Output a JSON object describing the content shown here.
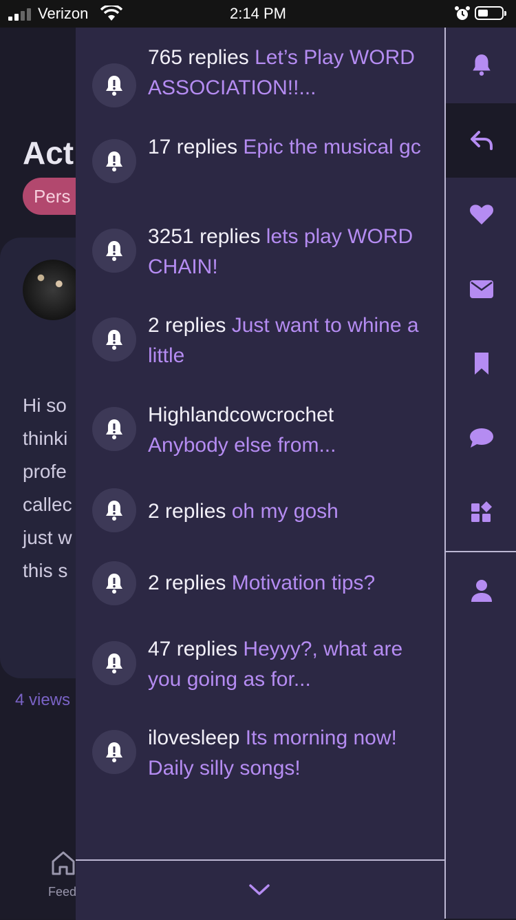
{
  "status_bar": {
    "carrier": "Verizon",
    "time": "2:14 PM"
  },
  "background": {
    "title": "Act",
    "chip": "Pers",
    "body_lines": [
      "Hi so",
      "thinki",
      "profe",
      "callec",
      "just w",
      "this s"
    ],
    "views": "4 views",
    "nav_feed_label": "Feed"
  },
  "notifications": [
    {
      "who": "765 replies",
      "topic": "Let’s Play WORD ASSOCIATION!!..."
    },
    {
      "who": "17 replies",
      "topic": "Epic the musical gc"
    },
    {
      "who": "3251 replies",
      "topic": "lets play WORD CHAIN!"
    },
    {
      "who": "2 replies",
      "topic": "Just want to whine a little"
    },
    {
      "who": "Highlandcowcrochet",
      "topic": "Anybody else from..."
    },
    {
      "who": "2 replies",
      "topic": "oh my gosh"
    },
    {
      "who": "2 replies",
      "topic": "Motivation tips?"
    },
    {
      "who": "47 replies",
      "topic": "Heyyy?, what are you going as for..."
    },
    {
      "who": "ilovesleep",
      "topic": "Its morning now! Daily silly songs!"
    }
  ],
  "rail": [
    {
      "icon": "bell-icon"
    },
    {
      "icon": "reply-icon",
      "active": true
    },
    {
      "icon": "heart-icon"
    },
    {
      "icon": "envelope-icon"
    },
    {
      "icon": "bookmark-icon"
    },
    {
      "icon": "chat-bubble-icon"
    },
    {
      "icon": "widgets-icon"
    },
    {
      "icon": "person-icon"
    }
  ],
  "colors": {
    "panel": "#2c2844",
    "accent": "#b58cf2",
    "rail_active": "#1b1a27"
  }
}
